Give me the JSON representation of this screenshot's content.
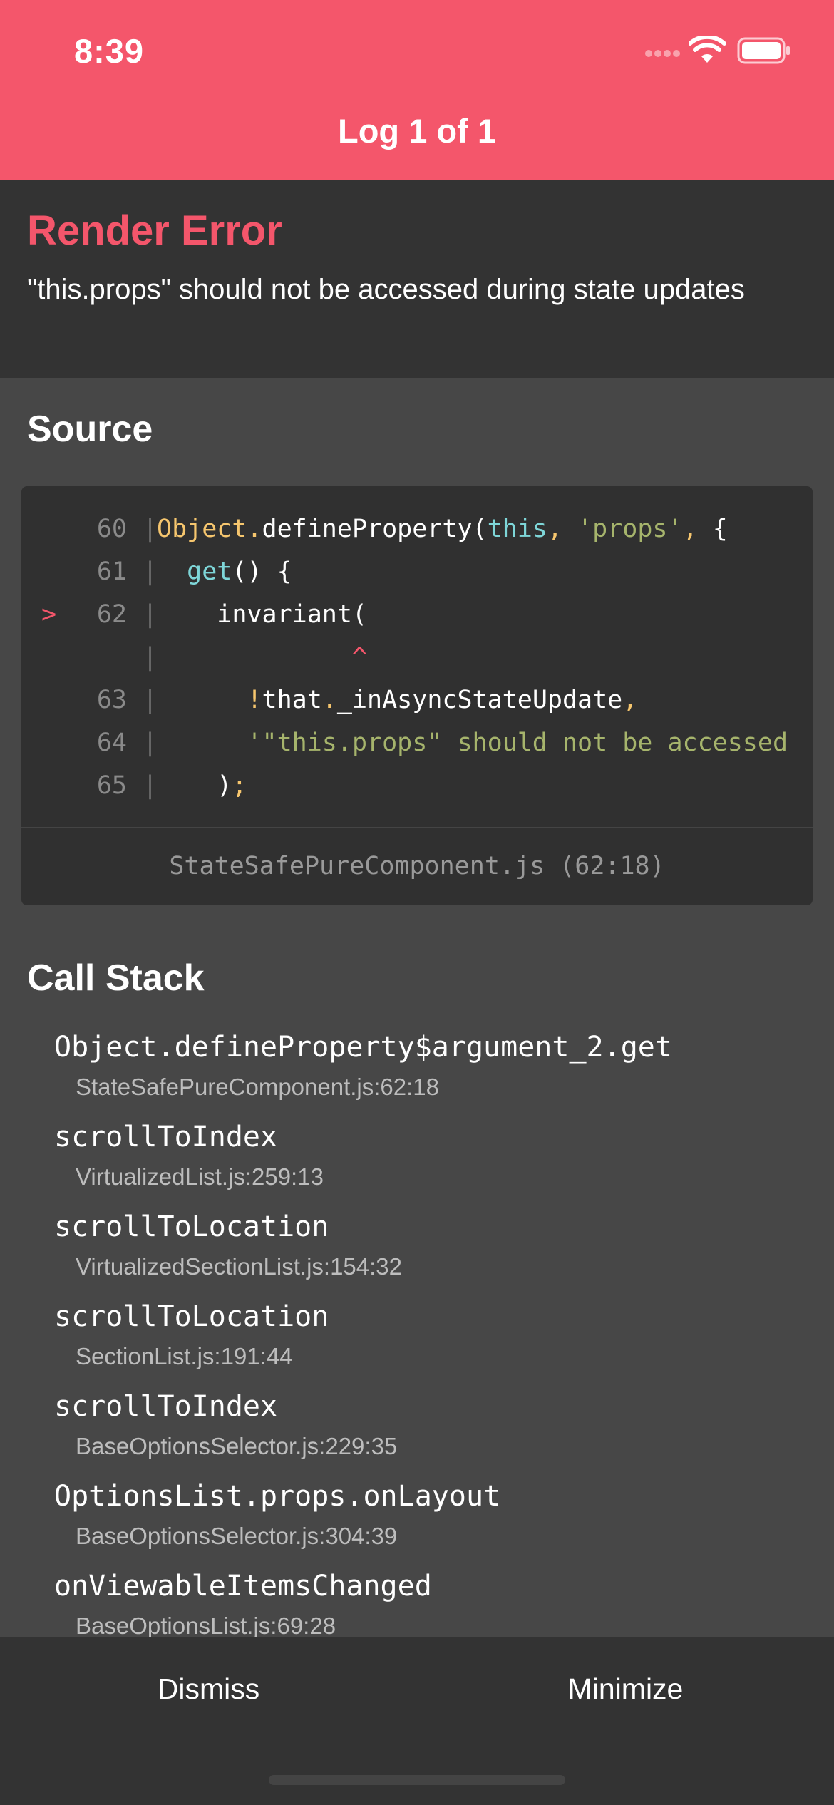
{
  "status_bar": {
    "time": "8:39",
    "icons": [
      "signal-dots-icon",
      "wifi-icon",
      "battery-icon"
    ]
  },
  "header": {
    "title": "Log 1 of 1"
  },
  "error": {
    "title": "Render Error",
    "message": "\"this.props\" should not be accessed during state updates"
  },
  "source": {
    "heading": "Source",
    "lines": [
      {
        "marker": "",
        "num": "60",
        "tokens": [
          [
            "t-obj",
            "Object"
          ],
          [
            "t-punc",
            "."
          ],
          [
            "",
            "defineProperty("
          ],
          [
            "t-kw",
            "this"
          ],
          [
            "t-punc",
            ", "
          ],
          [
            "t-str",
            "'props'"
          ],
          [
            "t-punc",
            ", "
          ],
          [
            "",
            "{"
          ]
        ]
      },
      {
        "marker": "",
        "num": "61",
        "tokens": [
          [
            "",
            "  "
          ],
          [
            "t-kw",
            "get"
          ],
          [
            "",
            "() {"
          ]
        ]
      },
      {
        "marker": ">",
        "num": "62",
        "tokens": [
          [
            "",
            "    invariant("
          ]
        ]
      },
      {
        "marker": "",
        "num": "",
        "tokens": [
          [
            "t-caret",
            "             ^"
          ]
        ]
      },
      {
        "marker": "",
        "num": "63",
        "tokens": [
          [
            "",
            "      "
          ],
          [
            "t-punc",
            "!"
          ],
          [
            "",
            "that"
          ],
          [
            "t-punc",
            "."
          ],
          [
            "",
            "_inAsyncStateUpdate"
          ],
          [
            "t-punc",
            ","
          ]
        ]
      },
      {
        "marker": "",
        "num": "64",
        "tokens": [
          [
            "",
            "      "
          ],
          [
            "t-str",
            "'\"this.props\" should not be accessed"
          ]
        ]
      },
      {
        "marker": "",
        "num": "65",
        "tokens": [
          [
            "",
            "    )"
          ],
          [
            "t-punc",
            ";"
          ]
        ]
      }
    ],
    "location": "StateSafePureComponent.js (62:18)"
  },
  "call_stack": {
    "heading": "Call Stack",
    "frames": [
      {
        "fn": "Object.defineProperty$argument_2.get",
        "file": "StateSafePureComponent.js:62:18"
      },
      {
        "fn": "scrollToIndex",
        "file": "VirtualizedList.js:259:13"
      },
      {
        "fn": "scrollToLocation",
        "file": "VirtualizedSectionList.js:154:32"
      },
      {
        "fn": "scrollToLocation",
        "file": "SectionList.js:191:44"
      },
      {
        "fn": "scrollToIndex",
        "file": "BaseOptionsSelector.js:229:35"
      },
      {
        "fn": "OptionsList.props.onLayout",
        "file": "BaseOptionsSelector.js:304:39"
      },
      {
        "fn": "onViewableItemsChanged",
        "file": "BaseOptionsList.js:69:28"
      }
    ]
  },
  "buttons": {
    "dismiss": "Dismiss",
    "minimize": "Minimize"
  },
  "colors": {
    "accent": "#f4566b",
    "panel": "#333333",
    "background": "#474747"
  }
}
